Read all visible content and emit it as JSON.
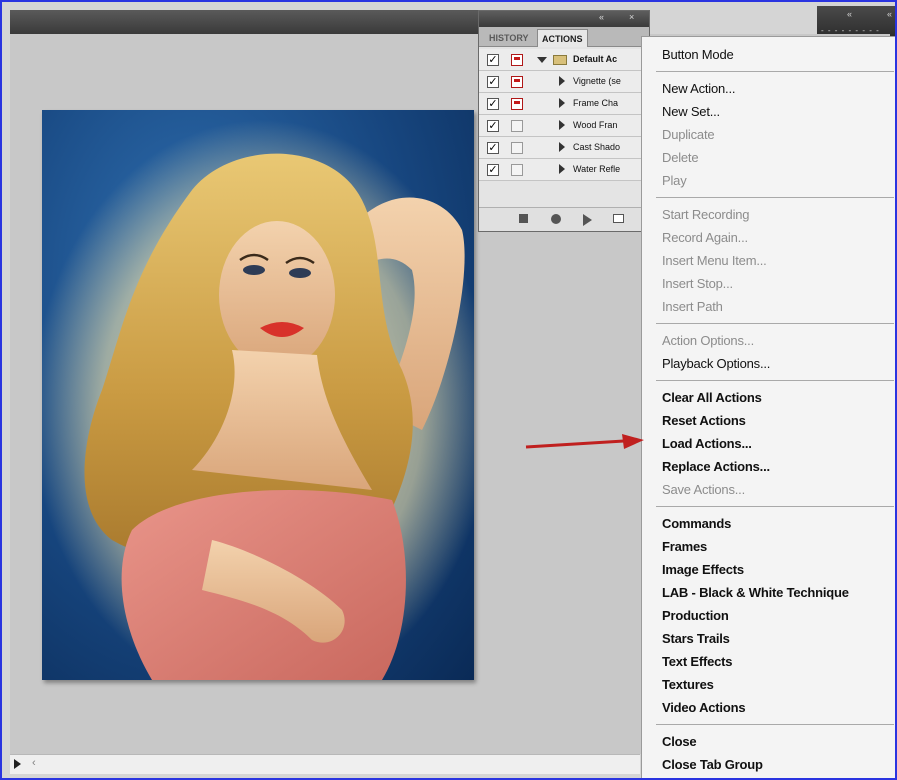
{
  "window": {
    "topbar_controls": [
      "«",
      "×"
    ],
    "topbar_right_controls": [
      "«",
      "«"
    ],
    "dock_strip": "- - - - - - - - -"
  },
  "panel": {
    "header_controls": [
      "«",
      "×"
    ],
    "tabs": [
      {
        "label": "HISTORY",
        "active": false
      },
      {
        "label": "ACTIONS",
        "active": true
      }
    ],
    "rows": [
      {
        "checked": "✓",
        "dialog": "red",
        "type": "set",
        "name": "Default Ac"
      },
      {
        "checked": "✓",
        "dialog": "red",
        "type": "action",
        "name": "Vignette (se"
      },
      {
        "checked": "✓",
        "dialog": "red",
        "type": "action",
        "name": "Frame Cha"
      },
      {
        "checked": "✓",
        "dialog": "none",
        "type": "action",
        "name": "Wood Fran"
      },
      {
        "checked": "✓",
        "dialog": "none",
        "type": "action",
        "name": "Cast Shado"
      },
      {
        "checked": "✓",
        "dialog": "none",
        "type": "action",
        "name": "Water Refle"
      }
    ]
  },
  "menu": {
    "items": [
      {
        "label": "Button Mode",
        "style": "en"
      },
      {
        "label": "New Action...",
        "style": "en"
      },
      {
        "label": "New Set...",
        "style": "en"
      },
      {
        "label": "Duplicate",
        "style": "dis"
      },
      {
        "label": "Delete",
        "style": "dis"
      },
      {
        "label": "Play",
        "style": "dis"
      },
      {
        "label": "Start Recording",
        "style": "dis"
      },
      {
        "label": "Record Again...",
        "style": "dis"
      },
      {
        "label": "Insert Menu Item...",
        "style": "dis"
      },
      {
        "label": "Insert Stop...",
        "style": "dis"
      },
      {
        "label": "Insert Path",
        "style": "dis"
      },
      {
        "label": "Action Options...",
        "style": "dis"
      },
      {
        "label": "Playback Options...",
        "style": "en"
      },
      {
        "label": "Clear All Actions",
        "style": "bold"
      },
      {
        "label": "Reset Actions",
        "style": "bold"
      },
      {
        "label": "Load Actions...",
        "style": "bold"
      },
      {
        "label": "Replace Actions...",
        "style": "bold"
      },
      {
        "label": "Save Actions...",
        "style": "dis"
      },
      {
        "label": "Commands",
        "style": "bold"
      },
      {
        "label": "Frames",
        "style": "bold"
      },
      {
        "label": "Image Effects",
        "style": "bold"
      },
      {
        "label": "LAB - Black & White Technique",
        "style": "bold"
      },
      {
        "label": "Production",
        "style": "bold"
      },
      {
        "label": "Stars Trails",
        "style": "bold"
      },
      {
        "label": "Text Effects",
        "style": "bold"
      },
      {
        "label": "Textures",
        "style": "bold"
      },
      {
        "label": "Video Actions",
        "style": "bold"
      },
      {
        "label": "Close",
        "style": "bold"
      },
      {
        "label": "Close Tab Group",
        "style": "bold"
      }
    ]
  },
  "scrollbar": {
    "left_glyph": "‹"
  },
  "colors": {
    "annotation_arrow": "#c0201f",
    "window_border": "#2a34e0"
  }
}
